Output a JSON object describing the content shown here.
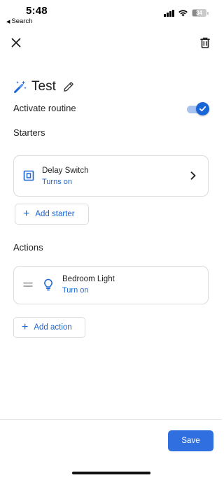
{
  "status_bar": {
    "time": "5:48",
    "back_label": "Search",
    "battery": "34"
  },
  "header": {
    "close_icon": "close-icon",
    "delete_icon": "trash-icon"
  },
  "routine": {
    "title": "Test",
    "activate_label": "Activate routine",
    "activated": true
  },
  "starters": {
    "section_label": "Starters",
    "items": [
      {
        "name": "Delay Switch",
        "state": "Turns on",
        "icon": "switch-icon"
      }
    ],
    "add_label": "Add starter"
  },
  "actions": {
    "section_label": "Actions",
    "items": [
      {
        "name": "Bedroom Light",
        "state": "Turn on",
        "icon": "lightbulb-icon"
      }
    ],
    "add_label": "Add action"
  },
  "footer": {
    "save_label": "Save"
  },
  "colors": {
    "accent": "#1a66d6",
    "save_button": "#2f6fe0",
    "border": "#dadce0"
  }
}
